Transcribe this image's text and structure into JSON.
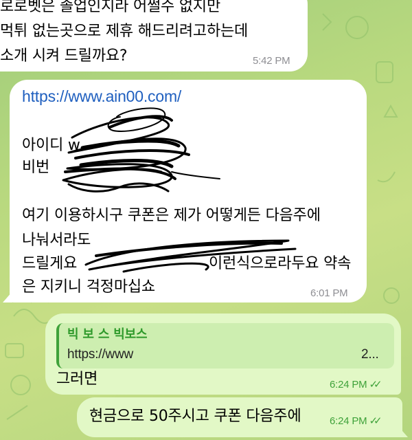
{
  "messages": [
    {
      "direction": "incoming",
      "lines": [
        "로로벳은 졸업인지라 어쩔수 없지만",
        "먹튀 없는곳으로 제휴 해드리려고하는데",
        "소개 시켜 드릴까요?"
      ],
      "time": "5:42 PM"
    },
    {
      "direction": "incoming",
      "link": "https://www.ain00.com/",
      "lines": [
        "아이디 w",
        "비번",
        "여기 이용하시구 쿠폰은 제가 어떻게든 다음주에",
        "나눠서라도",
        "드릴게요",
        "이런식으로라두요 약속",
        "은 지키니 걱정마십쇼"
      ],
      "time": "6:01 PM"
    },
    {
      "direction": "outgoing",
      "reply_sender": "빅 보 스 빅보스",
      "reply_text": "https://www",
      "reply_text_tail": "2...",
      "text": "그러면",
      "time": "6:24 PM",
      "ticks": "✓✓"
    },
    {
      "direction": "outgoing",
      "text": "현금으로 50주시고 쿠폰 다음주에",
      "time": "6:24 PM",
      "ticks": "✓✓"
    }
  ],
  "colors": {
    "incoming_bubble": "#ffffff",
    "outgoing_bubble": "#e2f8c6",
    "link": "#1f5fbf",
    "read_ticks": "#3fa23a",
    "background": "#b9d97f"
  }
}
